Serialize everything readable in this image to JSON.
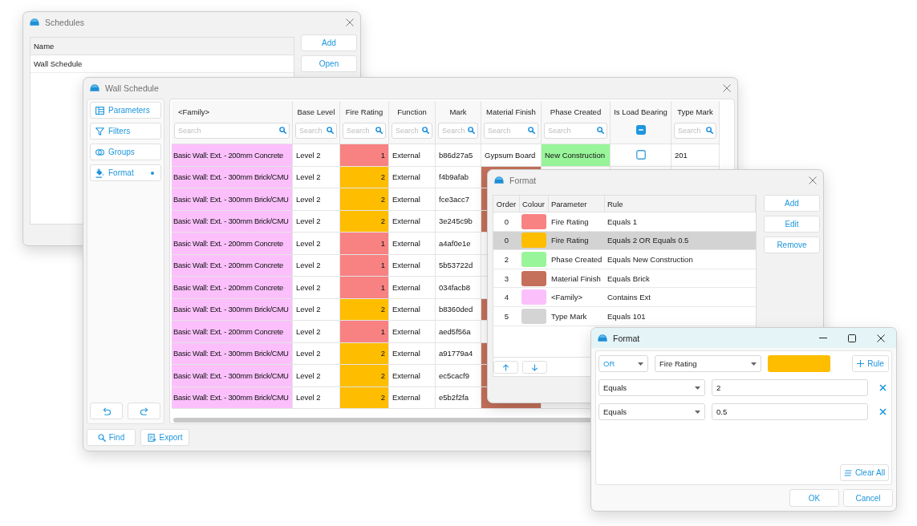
{
  "schedules_window": {
    "title": "Schedules",
    "list": {
      "column": "Name",
      "rows": [
        "Wall Schedule"
      ]
    },
    "buttons": [
      "Add",
      "Open"
    ]
  },
  "wall_schedule_window": {
    "title": "Wall Schedule",
    "sidebar": {
      "items": [
        {
          "label": "Parameters",
          "indicator": false
        },
        {
          "label": "Filters",
          "indicator": false
        },
        {
          "label": "Groups",
          "indicator": false
        },
        {
          "label": "Format",
          "indicator": true
        }
      ]
    },
    "table": {
      "columns": [
        {
          "label": "<Family>",
          "kind": "search",
          "placeholder": "Search"
        },
        {
          "label": "Base Level",
          "kind": "search",
          "placeholder": "Search"
        },
        {
          "label": "Fire Rating",
          "kind": "search",
          "placeholder": "Search"
        },
        {
          "label": "Function",
          "kind": "search",
          "placeholder": "Search"
        },
        {
          "label": "Mark",
          "kind": "search",
          "placeholder": "Search"
        },
        {
          "label": "Material Finish",
          "kind": "search",
          "placeholder": "Search"
        },
        {
          "label": "Phase Created",
          "kind": "search",
          "placeholder": "Search"
        },
        {
          "label": "Is Load Bearing",
          "kind": "checkbox",
          "indeterminate": true
        },
        {
          "label": "Type Mark",
          "kind": "search",
          "placeholder": "Search"
        }
      ],
      "rows": [
        {
          "cells": [
            {
              "text": "Basic Wall: Ext. - 200mm Concrete",
              "color": "#fbc0fb"
            },
            {
              "text": "Level 2"
            },
            {
              "text": "1",
              "color": "#f88181"
            },
            {
              "text": "External"
            },
            {
              "text": "b86d27a5"
            },
            {
              "text": "Gypsum Board"
            },
            {
              "text": "New Construction",
              "color": "#99f59a"
            },
            {
              "checked": false
            },
            {
              "text": "201"
            }
          ]
        },
        {
          "cells": [
            {
              "text": "Basic Wall: Ext. - 300mm Brick/CMU",
              "color": "#fbc0fb"
            },
            {
              "text": "Level 2"
            },
            {
              "text": "2",
              "color": "#ffbd00"
            },
            {
              "text": "External"
            },
            {
              "text": "f4b9afab"
            },
            {
              "color": "#c5705a"
            }
          ]
        },
        {
          "cells": [
            {
              "text": "Basic Wall: Ext. - 300mm Brick/CMU",
              "color": "#fbc0fb"
            },
            {
              "text": "Level 2"
            },
            {
              "text": "2",
              "color": "#ffbd00"
            },
            {
              "text": "External"
            },
            {
              "text": "fce3acc7"
            },
            {
              "color": "#c5705a"
            }
          ]
        },
        {
          "cells": [
            {
              "text": "Basic Wall: Ext. - 300mm Brick/CMU",
              "color": "#fbc0fb"
            },
            {
              "text": "Level 2"
            },
            {
              "text": "2",
              "color": "#ffbd00"
            },
            {
              "text": "External"
            },
            {
              "text": "3e245c9b"
            },
            {
              "color": "#c5705a"
            }
          ]
        },
        {
          "cells": [
            {
              "text": "Basic Wall: Ext. - 200mm Concrete",
              "color": "#fbc0fb"
            },
            {
              "text": "Level 2"
            },
            {
              "text": "1",
              "color": "#f88181"
            },
            {
              "text": "External"
            },
            {
              "text": "a4af0e1e"
            }
          ]
        },
        {
          "cells": [
            {
              "text": "Basic Wall: Ext. - 200mm Concrete",
              "color": "#fbc0fb"
            },
            {
              "text": "Level 2"
            },
            {
              "text": "1",
              "color": "#f88181"
            },
            {
              "text": "External"
            },
            {
              "text": "5b53722d"
            }
          ]
        },
        {
          "cells": [
            {
              "text": "Basic Wall: Ext. - 200mm Concrete",
              "color": "#fbc0fb"
            },
            {
              "text": "Level 2"
            },
            {
              "text": "1",
              "color": "#f88181"
            },
            {
              "text": "External"
            },
            {
              "text": "034facb8"
            }
          ]
        },
        {
          "cells": [
            {
              "text": "Basic Wall: Ext. - 300mm Brick/CMU",
              "color": "#fbc0fb"
            },
            {
              "text": "Level 2"
            },
            {
              "text": "2",
              "color": "#ffbd00"
            },
            {
              "text": "External"
            },
            {
              "text": "b8360ded"
            },
            {
              "color": "#c5705a"
            }
          ]
        },
        {
          "cells": [
            {
              "text": "Basic Wall: Ext. - 200mm Concrete",
              "color": "#fbc0fb"
            },
            {
              "text": "Level 2"
            },
            {
              "text": "1",
              "color": "#f88181"
            },
            {
              "text": "External"
            },
            {
              "text": "aed5f56a"
            }
          ]
        },
        {
          "cells": [
            {
              "text": "Basic Wall: Ext. - 300mm Brick/CMU",
              "color": "#fbc0fb"
            },
            {
              "text": "Level 2"
            },
            {
              "text": "2",
              "color": "#ffbd00"
            },
            {
              "text": "External"
            },
            {
              "text": "a91779a4"
            },
            {
              "color": "#c5705a"
            }
          ]
        },
        {
          "cells": [
            {
              "text": "Basic Wall: Ext. - 300mm Brick/CMU",
              "color": "#fbc0fb"
            },
            {
              "text": "Level 2"
            },
            {
              "text": "2",
              "color": "#ffbd00"
            },
            {
              "text": "External"
            },
            {
              "text": "ec5cacf9"
            },
            {
              "color": "#c5705a"
            }
          ]
        },
        {
          "cells": [
            {
              "text": "Basic Wall: Ext. - 300mm Brick/CMU",
              "color": "#fbc0fb"
            },
            {
              "text": "Level 2"
            },
            {
              "text": "2",
              "color": "#ffbd00"
            },
            {
              "text": "External"
            },
            {
              "text": "e5b2f2fa"
            },
            {
              "color": "#c5705a"
            }
          ]
        }
      ]
    },
    "footer_buttons": [
      "Find",
      "Export"
    ]
  },
  "format_rules_window": {
    "title": "Format",
    "columns": [
      "Order",
      "Colour",
      "Parameter",
      "Rule"
    ],
    "rules": [
      {
        "order": "0",
        "color": "#f88181",
        "parameter": "Fire Rating",
        "rule": "Equals 1",
        "selected": false
      },
      {
        "order": "0",
        "color": "#ffbd00",
        "parameter": "Fire Rating",
        "rule": "Equals 2 OR Equals 0.5",
        "selected": true
      },
      {
        "order": "2",
        "color": "#99f59a",
        "parameter": "Phase Created",
        "rule": "Equals New Construction",
        "selected": false
      },
      {
        "order": "3",
        "color": "#c5705a",
        "parameter": "Material Finish",
        "rule": "Equals Brick",
        "selected": false
      },
      {
        "order": "4",
        "color": "#fbc0fb",
        "parameter": "<Family>",
        "rule": "Contains Ext",
        "selected": false
      },
      {
        "order": "5",
        "color": "#d4d4d4",
        "parameter": "Type Mark",
        "rule": "Equals 101",
        "selected": false
      }
    ],
    "buttons": [
      "Add",
      "Edit",
      "Remove"
    ]
  },
  "format_dialog": {
    "title": "Format",
    "combinator": "OR",
    "parameter": "Fire Rating",
    "color": "#ffbd00",
    "add_rule_button": "Rule",
    "conditions": [
      {
        "operator": "Equals",
        "value": "2"
      },
      {
        "operator": "Equals",
        "value": "0.5"
      }
    ],
    "clear_button": "Clear All",
    "buttons": [
      "OK",
      "Cancel"
    ]
  }
}
